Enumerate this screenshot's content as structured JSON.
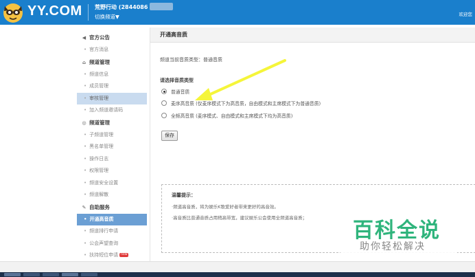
{
  "header": {
    "logo_text": "YY.COM",
    "channel_name": "荒野行动 (2844086",
    "switch_channel": "切换频道▼",
    "welcome": "欢迎您"
  },
  "sidebar": {
    "sections": [
      {
        "title": "官方公告",
        "icon": "speaker-icon",
        "items": [
          {
            "label": "官方消息",
            "state": "normal"
          }
        ]
      },
      {
        "title": "频道管理",
        "icon": "home-icon",
        "items": [
          {
            "label": "频道信息",
            "state": "normal"
          },
          {
            "label": "成员管理",
            "state": "normal"
          },
          {
            "label": "审核管理",
            "state": "highlight"
          },
          {
            "label": "加入频道邀请码",
            "state": "normal"
          }
        ]
      },
      {
        "title": "频道管理",
        "icon": "shield-icon",
        "items": [
          {
            "label": "子频道管理",
            "state": "normal"
          },
          {
            "label": "黑名单管理",
            "state": "normal"
          },
          {
            "label": "操作日志",
            "state": "normal"
          },
          {
            "label": "权限管理",
            "state": "normal"
          },
          {
            "label": "频道安全设置",
            "state": "normal"
          },
          {
            "label": "频道解散",
            "state": "normal"
          }
        ]
      },
      {
        "title": "自助服务",
        "icon": "wrench-icon",
        "items": [
          {
            "label": "开通高音质",
            "state": "active"
          },
          {
            "label": "频道排行申请",
            "state": "normal"
          },
          {
            "label": "公会声望查询",
            "state": "normal"
          },
          {
            "label": "扶持短位申请",
            "state": "normal",
            "badge": "new"
          }
        ]
      }
    ]
  },
  "main": {
    "title": "开通高音质",
    "current_type": "频道当前音质类型：普通音质",
    "select_label": "请选择音质类型",
    "options": [
      {
        "label": "普通音质",
        "checked": true
      },
      {
        "label": "麦序高音质 (仅麦序模式下为高音质，自由模式和主席模式下为普通音质)",
        "checked": false
      },
      {
        "label": "全频高音质 (麦序模式、自由模式和主席模式下均为高音质)",
        "checked": false
      }
    ],
    "save_label": "保存",
    "tips": {
      "title": "温馨提示：",
      "lines": [
        "·频道高音质，将为娱乐K歌爱好者带来更好的高音效。",
        "·高音质比普通音质占用稍高带宽，建议娱乐公会使用全频道高音质；"
      ]
    }
  },
  "annotation": {
    "color": "#f5f53a"
  },
  "watermark": {
    "big": "百科全说",
    "small": "助你轻松解决"
  },
  "colors": {
    "header": "#1a7fcc",
    "active_nav": "#6b9fd4",
    "highlight_nav": "#c9dbef",
    "watermark": "#2fb47c"
  }
}
